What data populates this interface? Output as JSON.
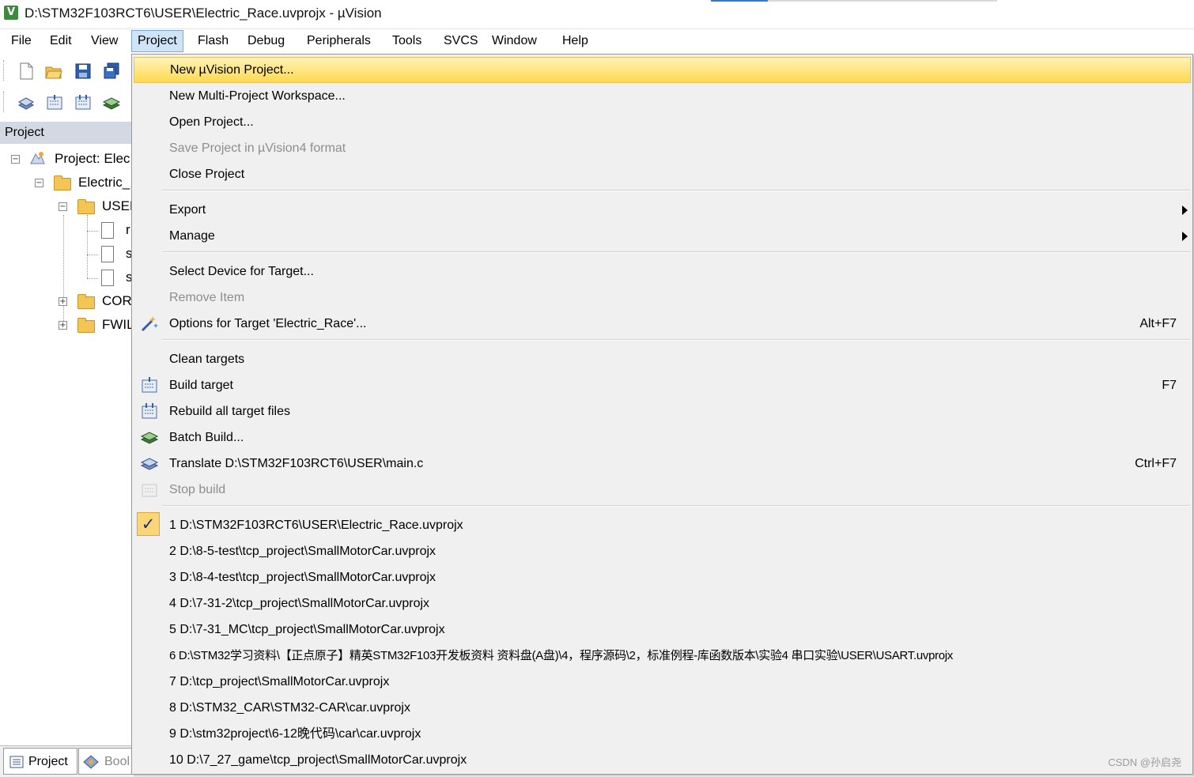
{
  "window": {
    "title": "D:\\STM32F103RCT6\\USER\\Electric_Race.uvprojx - µVision",
    "app_icon_glyph": "V"
  },
  "menubar": {
    "items": [
      "File",
      "Edit",
      "View",
      "Project",
      "Flash",
      "Debug",
      "Peripherals",
      "Tools",
      "SVCS",
      "Window",
      "Help"
    ],
    "active": "Project"
  },
  "left_pane": {
    "header": "Project",
    "tree": [
      {
        "label": "Project: Elec",
        "icon": "project-icon"
      },
      {
        "label": "Electric_",
        "icon": "target-icon"
      },
      {
        "label": "USER",
        "icon": "folder-icon"
      },
      {
        "label": "r",
        "icon": "file-icon"
      },
      {
        "label": "s",
        "icon": "file-icon"
      },
      {
        "label": "s",
        "icon": "file-icon"
      },
      {
        "label": "COR",
        "icon": "folder-icon"
      },
      {
        "label": "FWIL",
        "icon": "folder-icon"
      }
    ],
    "tabs": [
      "Project",
      "Bool"
    ]
  },
  "dropdown": {
    "items": [
      {
        "label": "New µVision Project...",
        "highlighted": true
      },
      {
        "label": "New Multi-Project Workspace..."
      },
      {
        "label": "Open Project..."
      },
      {
        "label": "Save Project in µVision4 format",
        "disabled": true
      },
      {
        "label": "Close Project"
      },
      {
        "label": "Export",
        "submenu": true
      },
      {
        "label": "Manage",
        "submenu": true
      },
      {
        "label": "Select Device for Target..."
      },
      {
        "label": "Remove Item",
        "disabled": true
      },
      {
        "label": "Options for Target 'Electric_Race'...",
        "shortcut": "Alt+F7",
        "icon": "magic-wand-icon"
      },
      {
        "label": "Clean targets"
      },
      {
        "label": "Build target",
        "shortcut": "F7",
        "icon": "build-icon"
      },
      {
        "label": "Rebuild all target files",
        "icon": "rebuild-icon"
      },
      {
        "label": "Batch Build...",
        "icon": "batch-build-icon"
      },
      {
        "label": "Translate D:\\STM32F103RCT6\\USER\\main.c",
        "shortcut": "Ctrl+F7",
        "icon": "translate-icon"
      },
      {
        "label": "Stop build",
        "disabled": true,
        "icon": "stop-build-icon"
      },
      {
        "label": "1 D:\\STM32F103RCT6\\USER\\Electric_Race.uvprojx",
        "checked": true
      },
      {
        "label": "2 D:\\8-5-test\\tcp_project\\SmallMotorCar.uvprojx"
      },
      {
        "label": "3 D:\\8-4-test\\tcp_project\\SmallMotorCar.uvprojx"
      },
      {
        "label": "4 D:\\7-31-2\\tcp_project\\SmallMotorCar.uvprojx"
      },
      {
        "label": "5 D:\\7-31_MC\\tcp_project\\SmallMotorCar.uvprojx"
      },
      {
        "label": "6 D:\\STM32学习资料\\【正点原子】精英STM32F103开发板资料 资料盘(A盘)\\4，程序源码\\2，标准例程-库函数版本\\实验4 串口实验\\USER\\USART.uvprojx"
      },
      {
        "label": "7 D:\\tcp_project\\SmallMotorCar.uvprojx"
      },
      {
        "label": "8 D:\\STM32_CAR\\STM32-CAR\\car.uvprojx"
      },
      {
        "label": "9 D:\\stm32project\\6-12晚代码\\car\\car.uvprojx"
      },
      {
        "label": "10 D:\\7_27_game\\tcp_project\\SmallMotorCar.uvprojx"
      }
    ]
  },
  "watermark": "CSDN @孙启尧",
  "colors": {
    "menu_highlight": "#ffd94f",
    "menubar_active": "#cfe4f7",
    "pane_header": "#d3d9e2",
    "menu_bg": "#f0f0f0"
  }
}
